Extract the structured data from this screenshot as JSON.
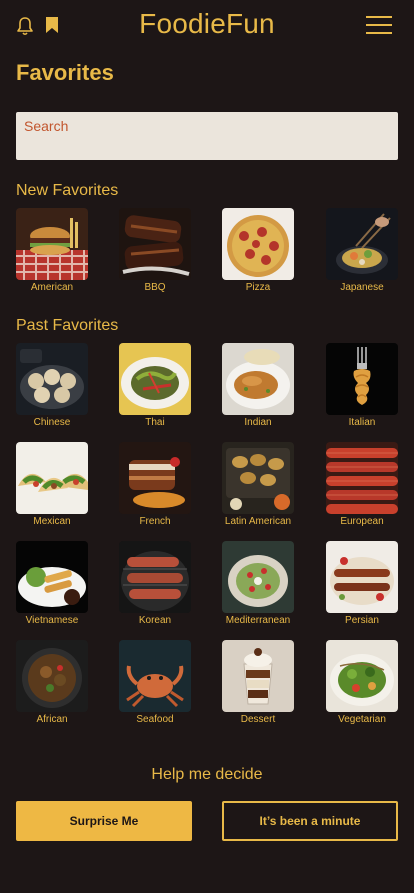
{
  "header": {
    "title": "FoodieFun"
  },
  "page_title": "Favorites",
  "search": {
    "placeholder": "Search"
  },
  "new_favorites": {
    "label": "New Favorites",
    "items": [
      {
        "name": "American"
      },
      {
        "name": "BBQ"
      },
      {
        "name": "Pizza"
      },
      {
        "name": "Japanese"
      }
    ]
  },
  "past_favorites": {
    "label": "Past Favorites",
    "items": [
      {
        "name": "Chinese"
      },
      {
        "name": "Thai"
      },
      {
        "name": "Indian"
      },
      {
        "name": "Italian"
      },
      {
        "name": "Mexican"
      },
      {
        "name": "French"
      },
      {
        "name": "Latin American"
      },
      {
        "name": "European"
      },
      {
        "name": "Vietnamese"
      },
      {
        "name": "Korean"
      },
      {
        "name": "Mediterranean"
      },
      {
        "name": "Persian"
      },
      {
        "name": "African"
      },
      {
        "name": "Seafood"
      },
      {
        "name": "Dessert"
      },
      {
        "name": "Vegetarian"
      }
    ]
  },
  "decide": {
    "heading": "Help me decide",
    "primary_label": "Surprise Me",
    "secondary_label": "It’s been a minute"
  },
  "colors": {
    "accent": "#e8b948",
    "background": "#1d1616",
    "search_bg": "#ebe5dc",
    "search_text": "#c2562e"
  },
  "icons": [
    "bell-icon",
    "bookmark-icon",
    "hamburger-menu-icon"
  ]
}
